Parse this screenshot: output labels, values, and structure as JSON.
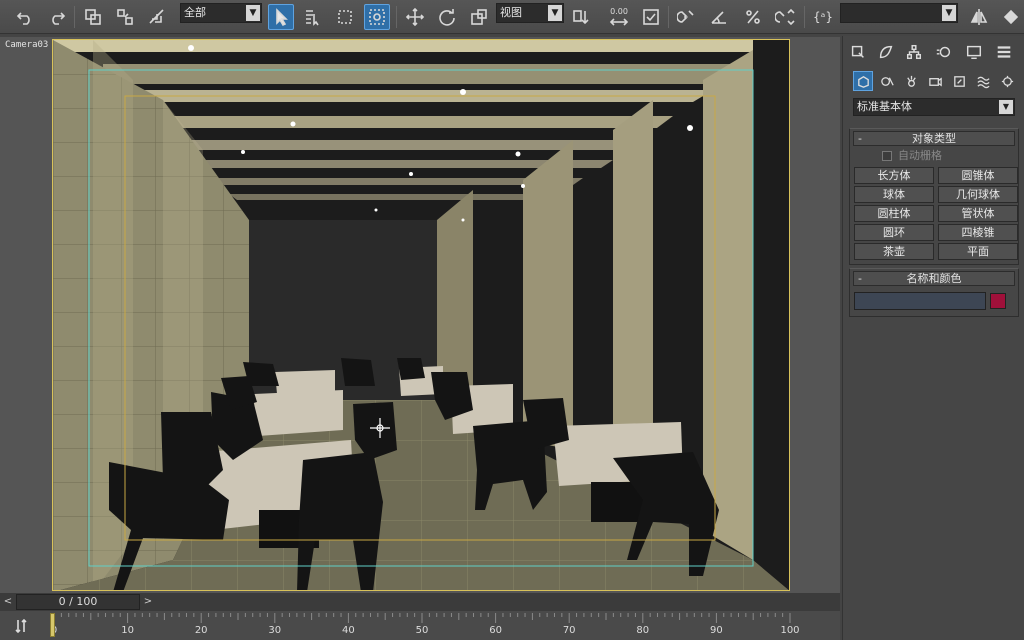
{
  "toolbar": {
    "selection_filter": "全部",
    "reference_coord": "视图",
    "snap_value": "0.00",
    "named_selection": ""
  },
  "viewport": {
    "label": "Camera03"
  },
  "command_panel": {
    "category": "标准基本体",
    "object_type": {
      "title": "对象类型",
      "collapse": "-",
      "autogrid_label": "自动栅格",
      "buttons": [
        "长方体",
        "圆锥体",
        "球体",
        "几何球体",
        "圆柱体",
        "管状体",
        "圆环",
        "四棱锥",
        "茶壶",
        "平面"
      ]
    },
    "name_color": {
      "title": "名称和颜色",
      "collapse": "-",
      "name_value": "",
      "color": "#a0103a"
    }
  },
  "timeline": {
    "frame_readout": "0 / 100",
    "prev": "<",
    "next": ">",
    "ticks": [
      "0",
      "10",
      "20",
      "30",
      "40",
      "50",
      "60",
      "70",
      "80",
      "90",
      "100"
    ]
  }
}
